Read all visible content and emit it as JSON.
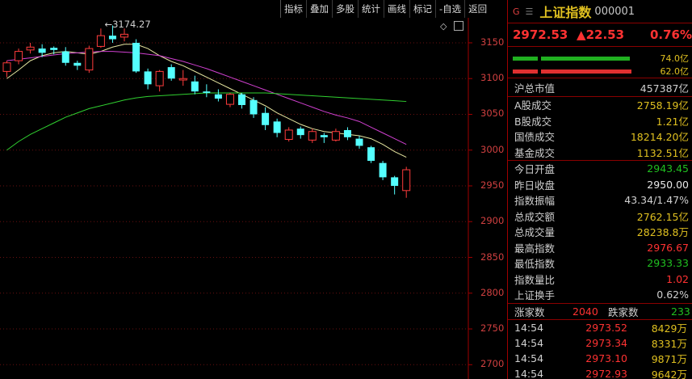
{
  "toolbar": [
    "指标",
    "叠加",
    "多股",
    "统计",
    "画线",
    "标记",
    "-自选",
    "返回"
  ],
  "chart": {
    "peak_label": "3174.27",
    "y_ticks": [
      "3150",
      "3100",
      "3050",
      "3000",
      "2950",
      "2900",
      "2850",
      "2800",
      "2750",
      "2700"
    ],
    "icons": {
      "settings": "diamond-icon",
      "zoom": "square-icon"
    }
  },
  "chart_data": {
    "type": "candlestick",
    "ylim": [
      2680,
      3185
    ],
    "candles": [
      {
        "o": 3110,
        "c": 3122,
        "h": 3125,
        "l": 3102
      },
      {
        "o": 3125,
        "c": 3138,
        "h": 3142,
        "l": 3120
      },
      {
        "o": 3140,
        "c": 3144,
        "h": 3150,
        "l": 3135
      },
      {
        "o": 3142,
        "c": 3136,
        "h": 3148,
        "l": 3130
      },
      {
        "o": 3143,
        "c": 3140,
        "h": 3145,
        "l": 3134
      },
      {
        "o": 3138,
        "c": 3122,
        "h": 3144,
        "l": 3118
      },
      {
        "o": 3122,
        "c": 3118,
        "h": 3125,
        "l": 3112
      },
      {
        "o": 3112,
        "c": 3142,
        "h": 3146,
        "l": 3108
      },
      {
        "o": 3145,
        "c": 3160,
        "h": 3170,
        "l": 3143
      },
      {
        "o": 3160,
        "c": 3155,
        "h": 3174.27,
        "l": 3150
      },
      {
        "o": 3158,
        "c": 3162,
        "h": 3170,
        "l": 3152
      },
      {
        "o": 3150,
        "c": 3110,
        "h": 3155,
        "l": 3108
      },
      {
        "o": 3110,
        "c": 3092,
        "h": 3114,
        "l": 3085
      },
      {
        "o": 3090,
        "c": 3110,
        "h": 3112,
        "l": 3082
      },
      {
        "o": 3116,
        "c": 3100,
        "h": 3120,
        "l": 3097
      },
      {
        "o": 3098,
        "c": 3100,
        "h": 3112,
        "l": 3090
      },
      {
        "o": 3096,
        "c": 3082,
        "h": 3104,
        "l": 3078
      },
      {
        "o": 3082,
        "c": 3080,
        "h": 3092,
        "l": 3074
      },
      {
        "o": 3078,
        "c": 3072,
        "h": 3085,
        "l": 3068
      },
      {
        "o": 3064,
        "c": 3078,
        "h": 3080,
        "l": 3060
      },
      {
        "o": 3078,
        "c": 3063,
        "h": 3080,
        "l": 3058
      },
      {
        "o": 3070,
        "c": 3050,
        "h": 3074,
        "l": 3045
      },
      {
        "o": 3052,
        "c": 3035,
        "h": 3060,
        "l": 3028
      },
      {
        "o": 3040,
        "c": 3024,
        "h": 3044,
        "l": 3018
      },
      {
        "o": 3015,
        "c": 3028,
        "h": 3032,
        "l": 3012
      },
      {
        "o": 3030,
        "c": 3021,
        "h": 3033,
        "l": 3016
      },
      {
        "o": 3014,
        "c": 3026,
        "h": 3030,
        "l": 3010
      },
      {
        "o": 3021,
        "c": 3018,
        "h": 3024,
        "l": 3010
      },
      {
        "o": 3014,
        "c": 3026,
        "h": 3030,
        "l": 3012
      },
      {
        "o": 3028,
        "c": 3018,
        "h": 3032,
        "l": 3014
      },
      {
        "o": 3016,
        "c": 3006,
        "h": 3020,
        "l": 3002
      },
      {
        "o": 3004,
        "c": 2985,
        "h": 3006,
        "l": 2982
      },
      {
        "o": 2982,
        "c": 2962,
        "h": 2985,
        "l": 2958
      },
      {
        "o": 2962,
        "c": 2950,
        "h": 2964,
        "l": 2938
      },
      {
        "o": 2943.45,
        "c": 2972.53,
        "h": 2976.67,
        "l": 2933.33
      }
    ],
    "ma_series": [
      {
        "color": "#e6e6a0",
        "values": [
          3100,
          3112,
          3125,
          3132,
          3136,
          3138,
          3136,
          3134,
          3138,
          3144,
          3148,
          3148,
          3142,
          3132,
          3124,
          3118,
          3110,
          3102,
          3094,
          3086,
          3078,
          3070,
          3062,
          3052,
          3044,
          3036,
          3030,
          3026,
          3024,
          3022,
          3020,
          3016,
          3008,
          2998,
          2990
        ]
      },
      {
        "color": "#d040d0",
        "values": [
          3125,
          3127,
          3129,
          3131,
          3133,
          3135,
          3136,
          3137,
          3138,
          3138,
          3137,
          3136,
          3134,
          3132,
          3128,
          3124,
          3119,
          3114,
          3108,
          3102,
          3096,
          3090,
          3084,
          3078,
          3072,
          3066,
          3060,
          3054,
          3049,
          3045,
          3040,
          3032,
          3024,
          3016,
          3008
        ]
      },
      {
        "color": "#30d030",
        "values": [
          3000,
          3012,
          3022,
          3030,
          3038,
          3046,
          3052,
          3058,
          3062,
          3066,
          3070,
          3073,
          3075,
          3076,
          3077,
          3078,
          3079,
          3080,
          3080,
          3080,
          3080,
          3080,
          3080,
          3079,
          3078,
          3077,
          3076,
          3075,
          3074,
          3073,
          3072,
          3071,
          3070,
          3069,
          3068
        ]
      }
    ]
  },
  "panel": {
    "g": "G",
    "menu_icon": "menu-icon",
    "name": "上证指数",
    "code": "000001",
    "price": "2972.53",
    "change": "▲22.53",
    "change_pct": "0.76%",
    "bar1_label": "74.0亿",
    "bar2_label": "62.0亿",
    "bar1_segments": [
      "#20b020",
      "#20b020"
    ],
    "bar2_segments": [
      "#e03030",
      "#e03030"
    ],
    "market": [
      {
        "label": "沪总市值",
        "value": "457387亿",
        "color": "#d0d0d0"
      }
    ],
    "turnover": [
      {
        "label": "A股成交",
        "value": "2758.19亿",
        "color": "#e0c020"
      },
      {
        "label": "B股成交",
        "value": "1.21亿",
        "color": "#e0c020"
      },
      {
        "label": "国债成交",
        "value": "18214.20亿",
        "color": "#e0c020"
      },
      {
        "label": "基金成交",
        "value": "1132.51亿",
        "color": "#e0c020"
      }
    ],
    "stats": [
      {
        "label": "今日开盘",
        "value": "2943.45",
        "color": "#20c020"
      },
      {
        "label": "昨日收盘",
        "value": "2950.00",
        "color": "#e8e8e8"
      },
      {
        "label": "指数振幅",
        "value": "43.34/1.47%",
        "color": "#d0d0d0"
      },
      {
        "label": "总成交额",
        "value": "2762.15亿",
        "color": "#e0c020"
      },
      {
        "label": "总成交量",
        "value": "28238.8万",
        "color": "#e0c020"
      },
      {
        "label": "最高指数",
        "value": "2976.67",
        "color": "#ff3232"
      },
      {
        "label": "最低指数",
        "value": "2933.33",
        "color": "#20c020"
      },
      {
        "label": "指数量比",
        "value": "1.02",
        "color": "#ff3232"
      },
      {
        "label": "上证换手",
        "value": "0.62%",
        "color": "#d0d0d0"
      }
    ],
    "up_label": "涨家数",
    "up_value": "2040",
    "down_label": "跌家数",
    "down_value": "233",
    "ticks": [
      {
        "time": "14:54",
        "price": "2973.52",
        "vol": "8429万"
      },
      {
        "time": "14:54",
        "price": "2973.34",
        "vol": "8331万"
      },
      {
        "time": "14:54",
        "price": "2973.10",
        "vol": "9871万"
      },
      {
        "time": "14:54",
        "price": "2972.93",
        "vol": "9642万"
      }
    ]
  }
}
